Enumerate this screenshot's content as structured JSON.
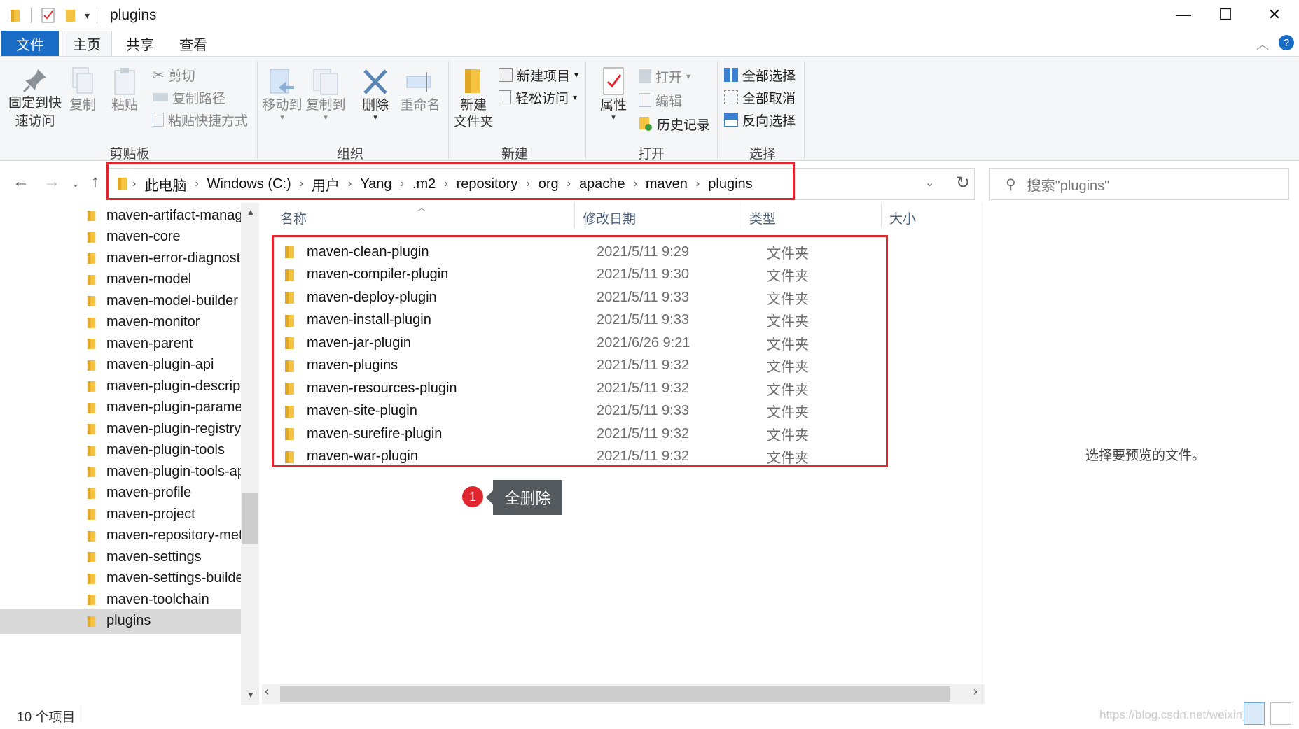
{
  "window": {
    "title": "plugins",
    "minimize": "—",
    "maximize": "☐",
    "close": "✕"
  },
  "ribbon_tabs": [
    "文件",
    "主页",
    "共享",
    "查看"
  ],
  "ribbon": {
    "clipboard": {
      "pin": "固定到快\n速访问",
      "copy": "复制",
      "paste": "粘贴",
      "cut": "剪切",
      "copy_path": "复制路径",
      "paste_shortcut": "粘贴快捷方式",
      "label": "剪贴板"
    },
    "organize": {
      "move_to": "移动到",
      "copy_to": "复制到",
      "delete": "删除",
      "rename": "重命名",
      "label": "组织"
    },
    "new": {
      "new_folder": "新建\n文件夹",
      "new_item": "新建项目",
      "easy_access": "轻松访问",
      "label": "新建"
    },
    "open": {
      "properties": "属性",
      "open": "打开",
      "edit": "编辑",
      "history": "历史记录",
      "label": "打开"
    },
    "select": {
      "select_all": "全部选择",
      "select_none": "全部取消",
      "invert": "反向选择",
      "label": "选择"
    }
  },
  "address": {
    "crumbs": [
      "此电脑",
      "Windows (C:)",
      "用户",
      "Yang",
      ".m2",
      "repository",
      "org",
      "apache",
      "maven",
      "plugins"
    ],
    "search_placeholder": "搜索\"plugins\""
  },
  "nav_pane": {
    "items": [
      "maven-artifact-manager",
      "maven-core",
      "maven-error-diagnostics",
      "maven-model",
      "maven-model-builder",
      "maven-monitor",
      "maven-parent",
      "maven-plugin-api",
      "maven-plugin-descriptor",
      "maven-plugin-parameter-documenter",
      "maven-plugin-registry",
      "maven-plugin-tools",
      "maven-plugin-tools-api",
      "maven-profile",
      "maven-project",
      "maven-repository-metadata",
      "maven-settings",
      "maven-settings-builder",
      "maven-toolchain",
      "plugins"
    ],
    "selected": "plugins"
  },
  "file_list": {
    "columns": [
      "名称",
      "修改日期",
      "类型",
      "大小"
    ],
    "rows": [
      {
        "name": "maven-clean-plugin",
        "date": "2021/5/11 9:29",
        "type": "文件夹"
      },
      {
        "name": "maven-compiler-plugin",
        "date": "2021/5/11 9:30",
        "type": "文件夹"
      },
      {
        "name": "maven-deploy-plugin",
        "date": "2021/5/11 9:33",
        "type": "文件夹"
      },
      {
        "name": "maven-install-plugin",
        "date": "2021/5/11 9:33",
        "type": "文件夹"
      },
      {
        "name": "maven-jar-plugin",
        "date": "2021/6/26 9:21",
        "type": "文件夹"
      },
      {
        "name": "maven-plugins",
        "date": "2021/5/11 9:32",
        "type": "文件夹"
      },
      {
        "name": "maven-resources-plugin",
        "date": "2021/5/11 9:32",
        "type": "文件夹"
      },
      {
        "name": "maven-site-plugin",
        "date": "2021/5/11 9:33",
        "type": "文件夹"
      },
      {
        "name": "maven-surefire-plugin",
        "date": "2021/5/11 9:32",
        "type": "文件夹"
      },
      {
        "name": "maven-war-plugin",
        "date": "2021/5/11 9:32",
        "type": "文件夹"
      }
    ]
  },
  "annotation": {
    "badge": "1",
    "text": "全删除"
  },
  "preview_pane": {
    "text": "选择要预览的文件。"
  },
  "status_bar": {
    "count": "10 个项目",
    "watermark": "https://blog.csdn.net/weixin_"
  },
  "colors": {
    "accent": "#1a6dc6",
    "highlight": "#e0262e",
    "folder": "#f5c242",
    "selected": "#cce8ff"
  }
}
